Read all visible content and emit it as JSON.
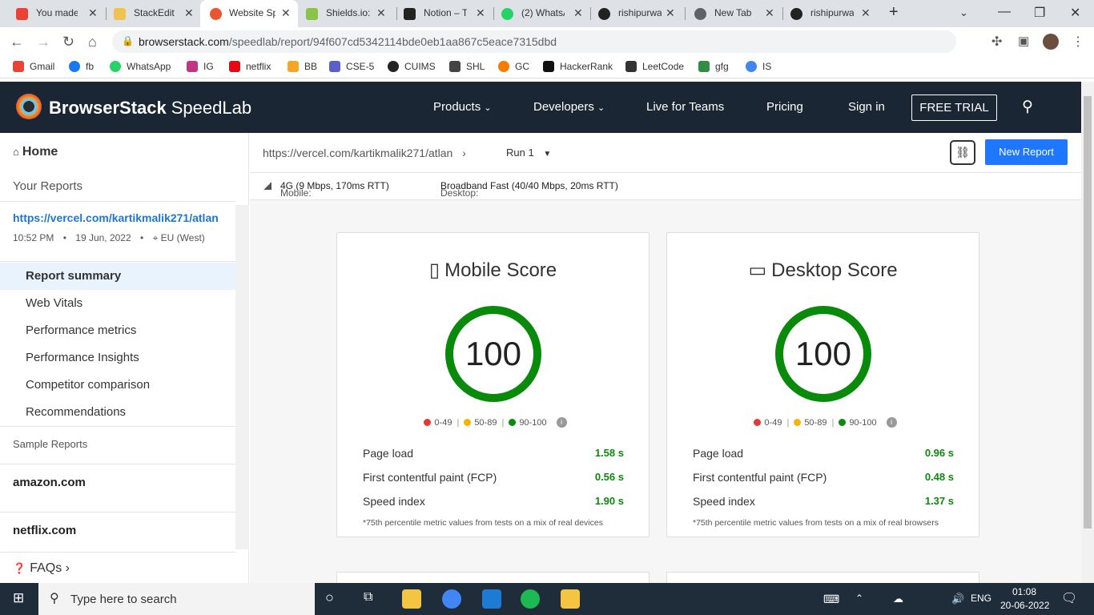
{
  "browser": {
    "tabs": [
      {
        "title": "You made",
        "fav": "#ea4335"
      },
      {
        "title": "StackEdit",
        "fav": "#f0c24f"
      },
      {
        "title": "Website Sp",
        "fav": "#e8552f"
      },
      {
        "title": "Shields.io:",
        "fav": "#8bc34a"
      },
      {
        "title": "Notion – T",
        "fav": "#222222"
      },
      {
        "title": "(2) WhatsA",
        "fav": "#25d366"
      },
      {
        "title": "rishipurwa",
        "fav": "#222222"
      },
      {
        "title": "New Tab",
        "fav": "#5f6368"
      },
      {
        "title": "rishipurwa",
        "fav": "#222222"
      }
    ],
    "url_host": "browserstack.com",
    "url_path": "/speedlab/report/94f607cd5342114bde0eb1aa867c5eace7315dbd",
    "bookmarks": [
      {
        "label": "Gmail",
        "color": "#ea4335"
      },
      {
        "label": "fb",
        "color": "#1877f2"
      },
      {
        "label": "WhatsApp",
        "color": "#25d366"
      },
      {
        "label": "IG",
        "color": "#c13584"
      },
      {
        "label": "netflix",
        "color": "#e50914"
      },
      {
        "label": "BB",
        "color": "#f5a623"
      },
      {
        "label": "CSE-5",
        "color": "#5b5fc7"
      },
      {
        "label": "CUIMS",
        "color": "#222222"
      },
      {
        "label": "SHL",
        "color": "#444444"
      },
      {
        "label": "GC",
        "color": "#f57c00"
      },
      {
        "label": "HackerRank",
        "color": "#111111"
      },
      {
        "label": "LeetCode",
        "color": "#333333"
      },
      {
        "label": "gfg",
        "color": "#2f8d46"
      },
      {
        "label": "IS",
        "color": "#4285f4"
      }
    ]
  },
  "site": {
    "brand": "BrowserStack",
    "product": "SpeedLab",
    "nav": [
      "Products",
      "Developers",
      "Live for Teams",
      "Pricing",
      "Sign in"
    ],
    "trial": "FREE TRIAL"
  },
  "sidebar": {
    "home": "Home",
    "your_reports": "Your Reports",
    "report_url": "https://vercel.com/kartikmalik271/atlan",
    "time": "10:52 PM",
    "date": "19 Jun, 2022",
    "region": "EU (West)",
    "items": [
      "Report summary",
      "Web Vitals",
      "Performance metrics",
      "Performance Insights",
      "Competitor comparison",
      "Recommendations"
    ],
    "sample_reports": "Sample Reports",
    "samples": [
      "amazon.com",
      "netflix.com"
    ],
    "faqs": "FAQs"
  },
  "report": {
    "url": "https://vercel.com/kartikmalik271/atlan",
    "run": "Run 1",
    "new_report": "New Report",
    "mobile_label": "Mobile:",
    "mobile_net": "4G (9 Mbps, 170ms RTT)",
    "desktop_label": "Desktop:",
    "desktop_net": "Broadband Fast (40/40 Mbps, 20ms RTT)",
    "legend": [
      "0-49",
      "50-89",
      "90-100"
    ],
    "mobile": {
      "title": "Mobile Score",
      "score": "100",
      "metrics": [
        {
          "label": "Page load",
          "value": "1.58 s"
        },
        {
          "label": "First contentful paint (FCP)",
          "value": "0.56 s"
        },
        {
          "label": "Speed index",
          "value": "1.90 s"
        }
      ],
      "note": "*75th percentile metric values from tests on a mix of real devices"
    },
    "desktop": {
      "title": "Desktop Score",
      "score": "100",
      "metrics": [
        {
          "label": "Page load",
          "value": "0.96 s"
        },
        {
          "label": "First contentful paint (FCP)",
          "value": "0.48 s"
        },
        {
          "label": "Speed index",
          "value": "1.37 s"
        }
      ],
      "note": "*75th percentile metric values from tests on a mix of real browsers"
    }
  },
  "taskbar": {
    "search": "Type here to search",
    "lang": "ENG",
    "time": "01:08",
    "date": "20-06-2022"
  }
}
